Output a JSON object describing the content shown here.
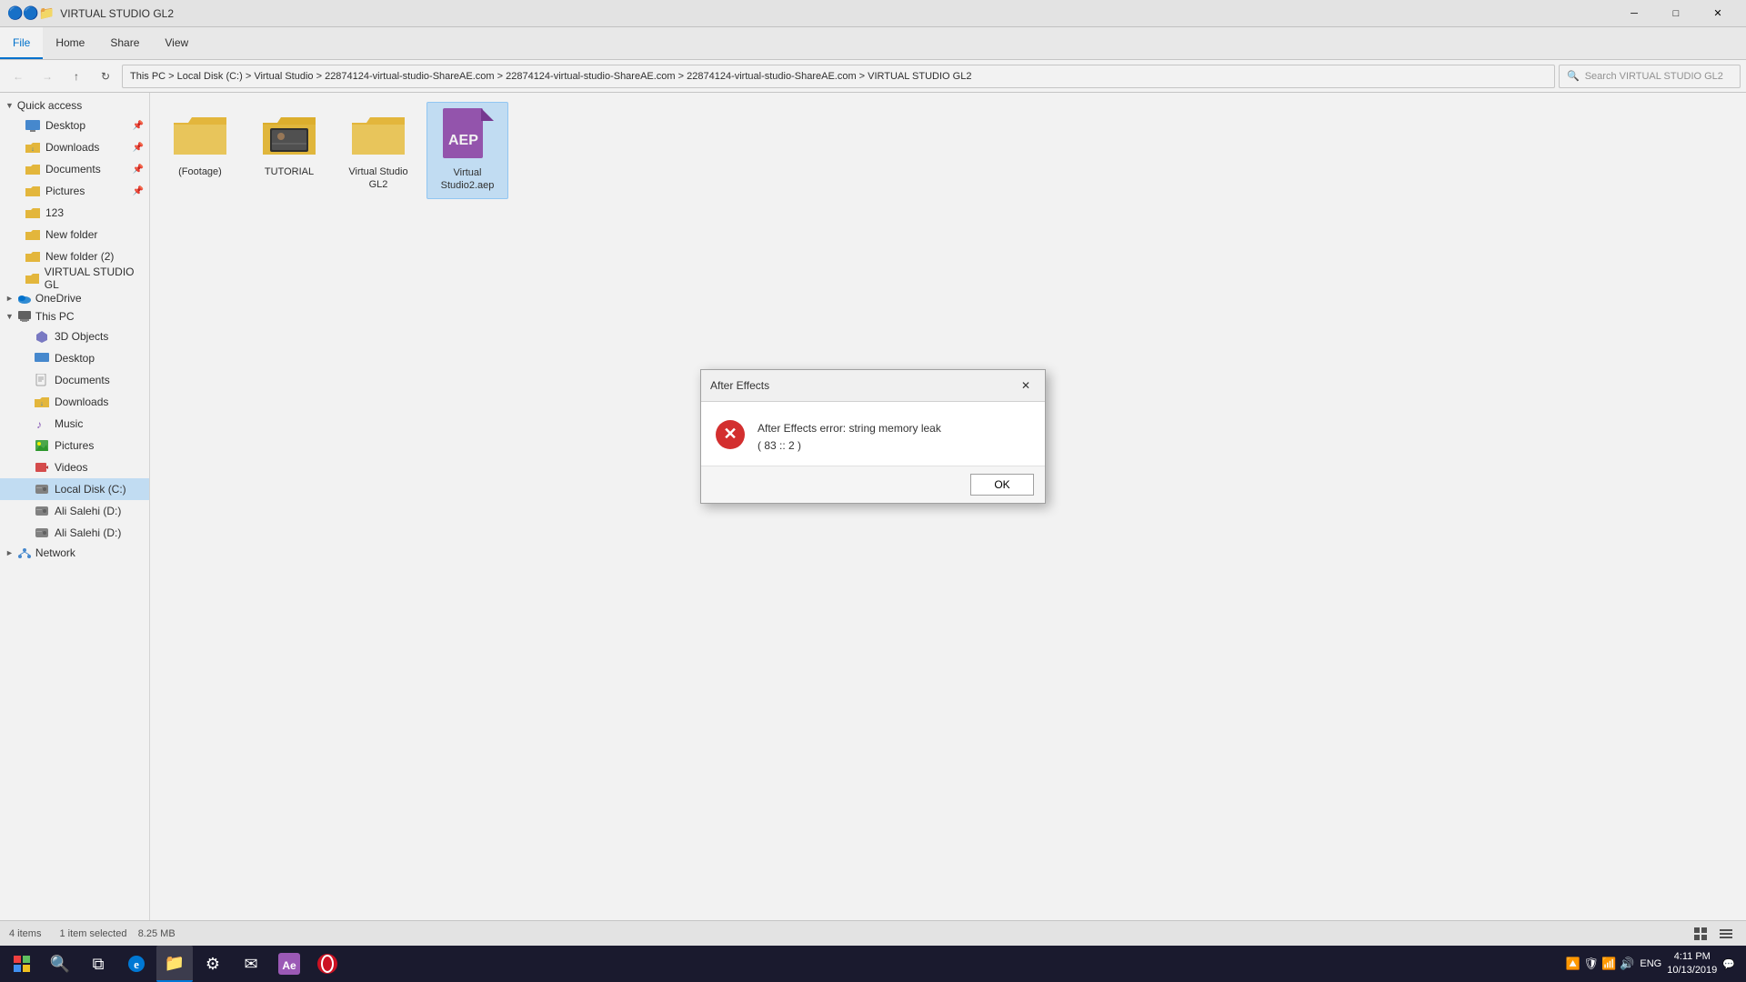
{
  "titleBar": {
    "title": "VIRTUAL STUDIO GL2",
    "appIcon": "📁",
    "minBtn": "─",
    "maxBtn": "□",
    "closeBtn": "✕"
  },
  "ribbon": {
    "tabs": [
      "File",
      "Home",
      "Share",
      "View"
    ],
    "activeTab": "Home"
  },
  "addressBar": {
    "path": "This PC > Local Disk (C:) > Virtual Studio > 22874124-virtual-studio-ShareAE.com > 22874124-virtual-studio-ShareAE.com > 22874124-virtual-studio-ShareAE.com > VIRTUAL STUDIO GL2",
    "searchPlaceholder": "Search VIRTUAL STUDIO GL2"
  },
  "sidebar": {
    "quickAccess": {
      "label": "Quick access",
      "items": [
        {
          "name": "Desktop",
          "pinned": true
        },
        {
          "name": "Downloads",
          "pinned": true
        },
        {
          "name": "Documents",
          "pinned": true
        },
        {
          "name": "Pictures",
          "pinned": true
        },
        {
          "name": "123",
          "pinned": false
        },
        {
          "name": "New folder",
          "pinned": false
        },
        {
          "name": "New folder (2)",
          "pinned": false
        },
        {
          "name": "VIRTUAL STUDIO GL",
          "pinned": false
        }
      ]
    },
    "oneDrive": {
      "label": "OneDrive",
      "expanded": false
    },
    "thisPC": {
      "label": "This PC",
      "expanded": true,
      "items": [
        {
          "name": "3D Objects"
        },
        {
          "name": "Desktop"
        },
        {
          "name": "Documents"
        },
        {
          "name": "Downloads"
        },
        {
          "name": "Music"
        },
        {
          "name": "Pictures"
        },
        {
          "name": "Videos"
        },
        {
          "name": "Local Disk (C:)",
          "active": true
        },
        {
          "name": "Ali Salehi (D:)"
        },
        {
          "name": "Ali Salehi (D:)"
        }
      ]
    },
    "network": {
      "label": "Network",
      "expanded": false
    }
  },
  "files": [
    {
      "name": "(Footage)",
      "type": "folder",
      "selected": false
    },
    {
      "name": "TUTORIAL",
      "type": "folder-image",
      "selected": false
    },
    {
      "name": "Virtual Studio GL2",
      "type": "folder",
      "selected": false
    },
    {
      "name": "Virtual Studio2.aep",
      "type": "aep",
      "selected": true
    }
  ],
  "statusBar": {
    "itemCount": "4 items",
    "selectedInfo": "1 item selected",
    "fileSize": "8.25 MB"
  },
  "dialog": {
    "title": "After Effects",
    "errorMessage": "After Effects error: string memory leak",
    "errorCode": "( 83 :: 2 )",
    "okLabel": "OK"
  },
  "taskbar": {
    "time": "4:11 PM",
    "date": "10/13/2019",
    "language": "ENG"
  }
}
